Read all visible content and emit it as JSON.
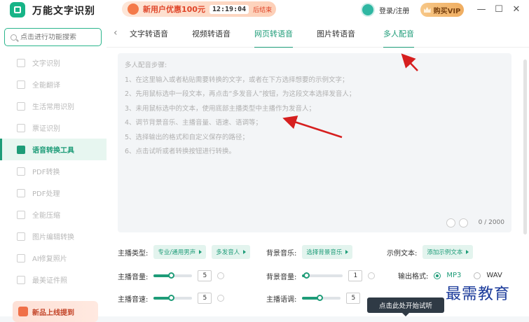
{
  "app": {
    "title": "万能文字识别"
  },
  "promo": {
    "text": "新用户优惠100元",
    "time": "12:19:04",
    "suffix": "后结束"
  },
  "user": {
    "login": "登录/注册"
  },
  "vip": {
    "label": "购买VIP"
  },
  "window": {
    "minimize": "—",
    "maximize": "☐",
    "close": "✕"
  },
  "sidebar": {
    "search_placeholder": "点击进行功能搜索",
    "items": [
      {
        "label": "文字识别"
      },
      {
        "label": "全能翻译"
      },
      {
        "label": "生活常用识别"
      },
      {
        "label": "票证识别"
      },
      {
        "label": "语音转换工具",
        "active": true
      },
      {
        "label": "PDF转换"
      },
      {
        "label": "PDF处理"
      },
      {
        "label": "全能压缩"
      },
      {
        "label": "图片编辑转换"
      },
      {
        "label": "AI修复照片"
      },
      {
        "label": "最美证件照"
      }
    ],
    "banner": "新品上线提到"
  },
  "tabs": {
    "back": "‹",
    "items": [
      {
        "label": "文字转语音"
      },
      {
        "label": "视频转语音"
      },
      {
        "label": "网页转语音",
        "active": true
      },
      {
        "label": "图片转语音"
      },
      {
        "label": "多人配音"
      }
    ]
  },
  "editor": {
    "steps": [
      "多人配音步骤:",
      "1、在这里输入或者粘贴需要转换的文字，或者在下方选择想要的示例文字；",
      "2、先用鼠标选中一段文本，再点击“多发音人”按钮，为这段文本选择发音人；",
      "3、未用鼠标选中的文本，使用底部主播类型中主播作为发音人；",
      "4、调节背景音乐、主播音量、语速、语调等；",
      "5、选择输出的格式和自定义保存的路径；",
      "6、点击试听或者转换按钮进行转换。"
    ],
    "counter": "0 / 2000"
  },
  "controls": {
    "anchor_type_label": "主播类型:",
    "anchor_type_value": "专业/通用男声",
    "multi_voice": "多发音人",
    "bgm_label": "背景音乐:",
    "bgm_value": "选择背景音乐",
    "example_label": "示例文本:",
    "example_value": "添加示例文本",
    "anchor_volume_label": "主播音量:",
    "anchor_volume_value": "5",
    "anchor_volume_level": 0.45,
    "bgm_volume_label": "背景音量:",
    "bgm_volume_value": "1",
    "bgm_volume_level": 0.1,
    "format_label": "输出格式:",
    "formats": [
      {
        "label": "MP3",
        "selected": true
      },
      {
        "label": "WAV",
        "selected": false
      }
    ],
    "speed_label": "主播音速:",
    "speed_value": "5",
    "speed_level": 0.45,
    "pitch_label": "主播语调:",
    "pitch_value": "5",
    "pitch_level": 0.45
  },
  "tooltip": "点击此处开始试听",
  "watermark": "最需教育",
  "annotation_color": "#d61f1f"
}
